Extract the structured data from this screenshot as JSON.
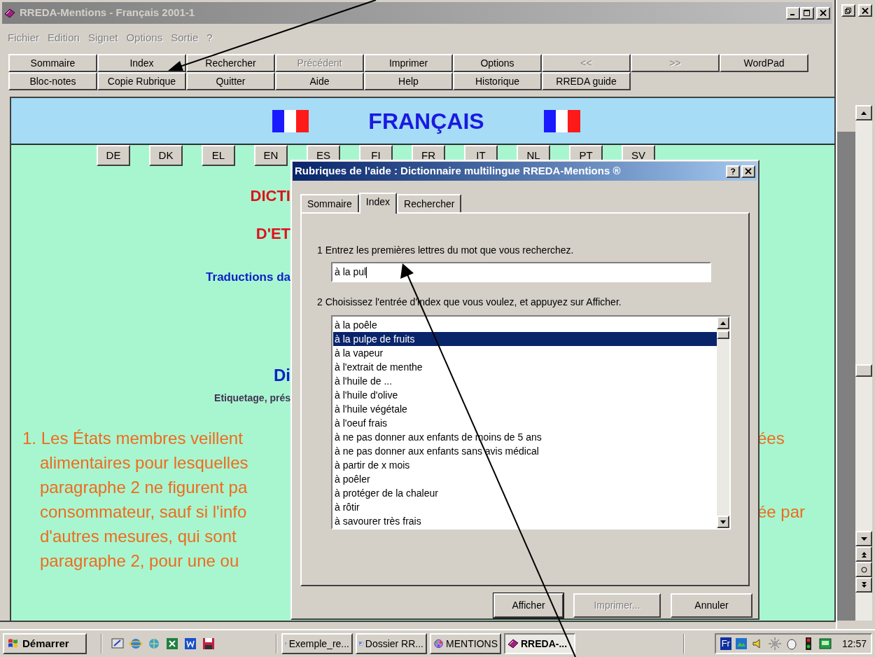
{
  "window": {
    "title": "RREDA-Mentions - Français 2001-1"
  },
  "menu": [
    {
      "label": "Fichier",
      "disabled": true
    },
    {
      "label": "Edition",
      "disabled": true
    },
    {
      "label": "Signet",
      "disabled": true
    },
    {
      "label": "Options",
      "disabled": true
    },
    {
      "label": "Sortie",
      "disabled": true
    },
    {
      "label": "?",
      "disabled": true
    }
  ],
  "toolbar": [
    [
      {
        "label": "Sommaire",
        "disabled": false
      },
      {
        "label": "Index",
        "disabled": false
      },
      {
        "label": "Rechercher",
        "disabled": false
      },
      {
        "label": "Précédent",
        "disabled": true
      },
      {
        "label": "Imprimer",
        "disabled": false
      },
      {
        "label": "Options",
        "disabled": false
      },
      {
        "label": "<<",
        "disabled": true
      },
      {
        "label": ">>",
        "disabled": true
      },
      {
        "label": "WordPad",
        "disabled": false
      }
    ],
    [
      {
        "label": "Bloc-notes",
        "disabled": false
      },
      {
        "label": "Copie Rubrique",
        "disabled": false
      },
      {
        "label": "Quitter",
        "disabled": false
      },
      {
        "label": "Aide",
        "disabled": false
      },
      {
        "label": "Help",
        "disabled": false
      },
      {
        "label": "Historique",
        "disabled": false
      },
      {
        "label": "RREDA guide",
        "disabled": false
      }
    ]
  ],
  "header": {
    "title": "FRANÇAIS"
  },
  "languages": [
    "DE",
    "DK",
    "EL",
    "EN",
    "ES",
    "FI",
    "FR",
    "IT",
    "NL",
    "PT",
    "SV"
  ],
  "content": {
    "headings": [
      {
        "text": "DICTI",
        "kind": "title"
      },
      {
        "text": "D'ET",
        "kind": "title"
      },
      {
        "text": "Traductions da",
        "kind": "subtitle"
      },
      {
        "text": "Di",
        "kind": "section"
      },
      {
        "text": "Etiquetage, prés",
        "kind": "caption"
      }
    ],
    "paragraph": [
      {
        "left": "1. Les États membres veillent",
        "right": "ées"
      },
      {
        "left": "alimentaires pour lesquelles"
      },
      {
        "left": "paragraphe 2 ne figurent pa"
      },
      {
        "left": "consommateur, sauf si l'info",
        "right": "ée par"
      },
      {
        "left": "d'autres mesures, qui sont"
      },
      {
        "left": "paragraphe 2, pour une ou"
      }
    ]
  },
  "dialog": {
    "title": "Rubriques de l'aide : Dictionnaire multilingue RREDA-Mentions ®",
    "tabs": [
      {
        "label": "Sommaire",
        "selected": false
      },
      {
        "label": "Index",
        "selected": true
      },
      {
        "label": "Rechercher",
        "selected": false
      }
    ],
    "step1": "1  Entrez les premières lettres du mot que vous recherchez.",
    "search": {
      "value": "à la pul"
    },
    "step2": "2  Choisissez l'entrée d'index que vous voulez, et appuyez sur Afficher.",
    "list": [
      {
        "label": "à la poêle",
        "selected": false
      },
      {
        "label": "à la pulpe de fruits",
        "selected": true
      },
      {
        "label": "à la vapeur",
        "selected": false
      },
      {
        "label": "à l'extrait de menthe",
        "selected": false
      },
      {
        "label": "à l'huile de ...",
        "selected": false
      },
      {
        "label": "à l'huile d'olive",
        "selected": false
      },
      {
        "label": "à l'huile végétale",
        "selected": false
      },
      {
        "label": "à l'oeuf frais",
        "selected": false
      },
      {
        "label": "à ne pas donner aux enfants de moins de 5 ans",
        "selected": false
      },
      {
        "label": "à ne pas donner aux enfants sans avis médical",
        "selected": false
      },
      {
        "label": "à partir de x mois",
        "selected": false
      },
      {
        "label": "à poêler",
        "selected": false
      },
      {
        "label": "à protéger de la chaleur",
        "selected": false
      },
      {
        "label": "à rôtir",
        "selected": false
      },
      {
        "label": "à savourer très frais",
        "selected": false
      }
    ],
    "buttons": [
      {
        "label": "Afficher",
        "disabled": false,
        "default": true
      },
      {
        "label": "Imprimer...",
        "disabled": true,
        "default": false
      },
      {
        "label": "Annuler",
        "disabled": false,
        "default": false
      }
    ]
  },
  "taskbar": {
    "start": "Démarrer",
    "tasks": [
      {
        "label": "Exemple_re...",
        "kind": "document",
        "selected": false
      },
      {
        "label": "Dossier RR...",
        "kind": "document",
        "selected": false
      },
      {
        "label": "MENTIONS",
        "kind": "network",
        "selected": false
      },
      {
        "label": "RREDA-...",
        "kind": "book",
        "selected": true
      }
    ],
    "language": "Fr",
    "clock": "12:57"
  }
}
